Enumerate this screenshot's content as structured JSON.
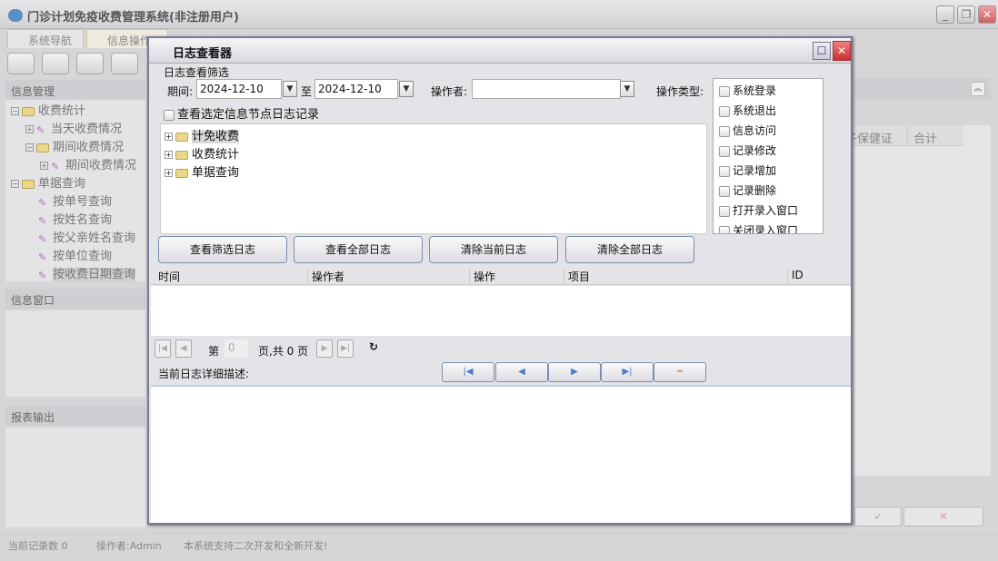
{
  "app": {
    "title": "门诊计划免疫收费管理系统(非注册用户)"
  },
  "tabs": [
    {
      "label": "系统导航"
    },
    {
      "label": "信息操作"
    }
  ],
  "left": {
    "info_header": "信息管理",
    "tree": [
      {
        "label": "收费统计",
        "type": "folder",
        "expanded": true
      },
      {
        "label": "当天收费情况",
        "type": "item"
      },
      {
        "label": "期间收费情况",
        "type": "folder",
        "expanded": true
      },
      {
        "label": "期间收费情况",
        "type": "item"
      },
      {
        "label": "单据查询",
        "type": "folder",
        "expanded": true
      },
      {
        "label": "按单号查询",
        "type": "item"
      },
      {
        "label": "按姓名查询",
        "type": "item"
      },
      {
        "label": "按父亲姓名查询",
        "type": "item"
      },
      {
        "label": "按单位查询",
        "type": "item"
      },
      {
        "label": "按收费日期查询",
        "type": "item",
        "selected": true
      }
    ],
    "window_header": "信息窗口",
    "report_header": "报表输出"
  },
  "right": {
    "columns": [
      "子保健证",
      "合计"
    ],
    "ok": "✓",
    "cancel": "✕"
  },
  "status": {
    "records": "当前记录数 0",
    "operator": "操作者:Admin",
    "note": "本系统支持二次开发和全新开发!"
  },
  "dialog": {
    "title": "日志查看器",
    "filter_label": "日志查看筛选",
    "period_label": "期间:",
    "date_from": "2024-12-10",
    "to_label": "至",
    "date_to": "2024-12-10",
    "operator_label": "操作者:",
    "operator_value": "",
    "optype_label": "操作类型:",
    "op_types": [
      "系统登录",
      "系统退出",
      "信息访问",
      "记录修改",
      "记录增加",
      "记录删除",
      "打开录入窗口",
      "关闭录入窗口"
    ],
    "node_check_label": "查看选定信息节点日志记录",
    "tree": [
      "计免收费",
      "收费统计",
      "单据查询"
    ],
    "buttons": [
      "查看筛选日志",
      "查看全部日志",
      "清除当前日志",
      "清除全部日志"
    ],
    "columns": [
      "时间",
      "操作者",
      "操作",
      "项目",
      "ID"
    ],
    "pager": {
      "prefix": "第",
      "page": "0",
      "suffix": "页,共 0 页"
    },
    "detail_label": "当前日志详细描述:"
  }
}
